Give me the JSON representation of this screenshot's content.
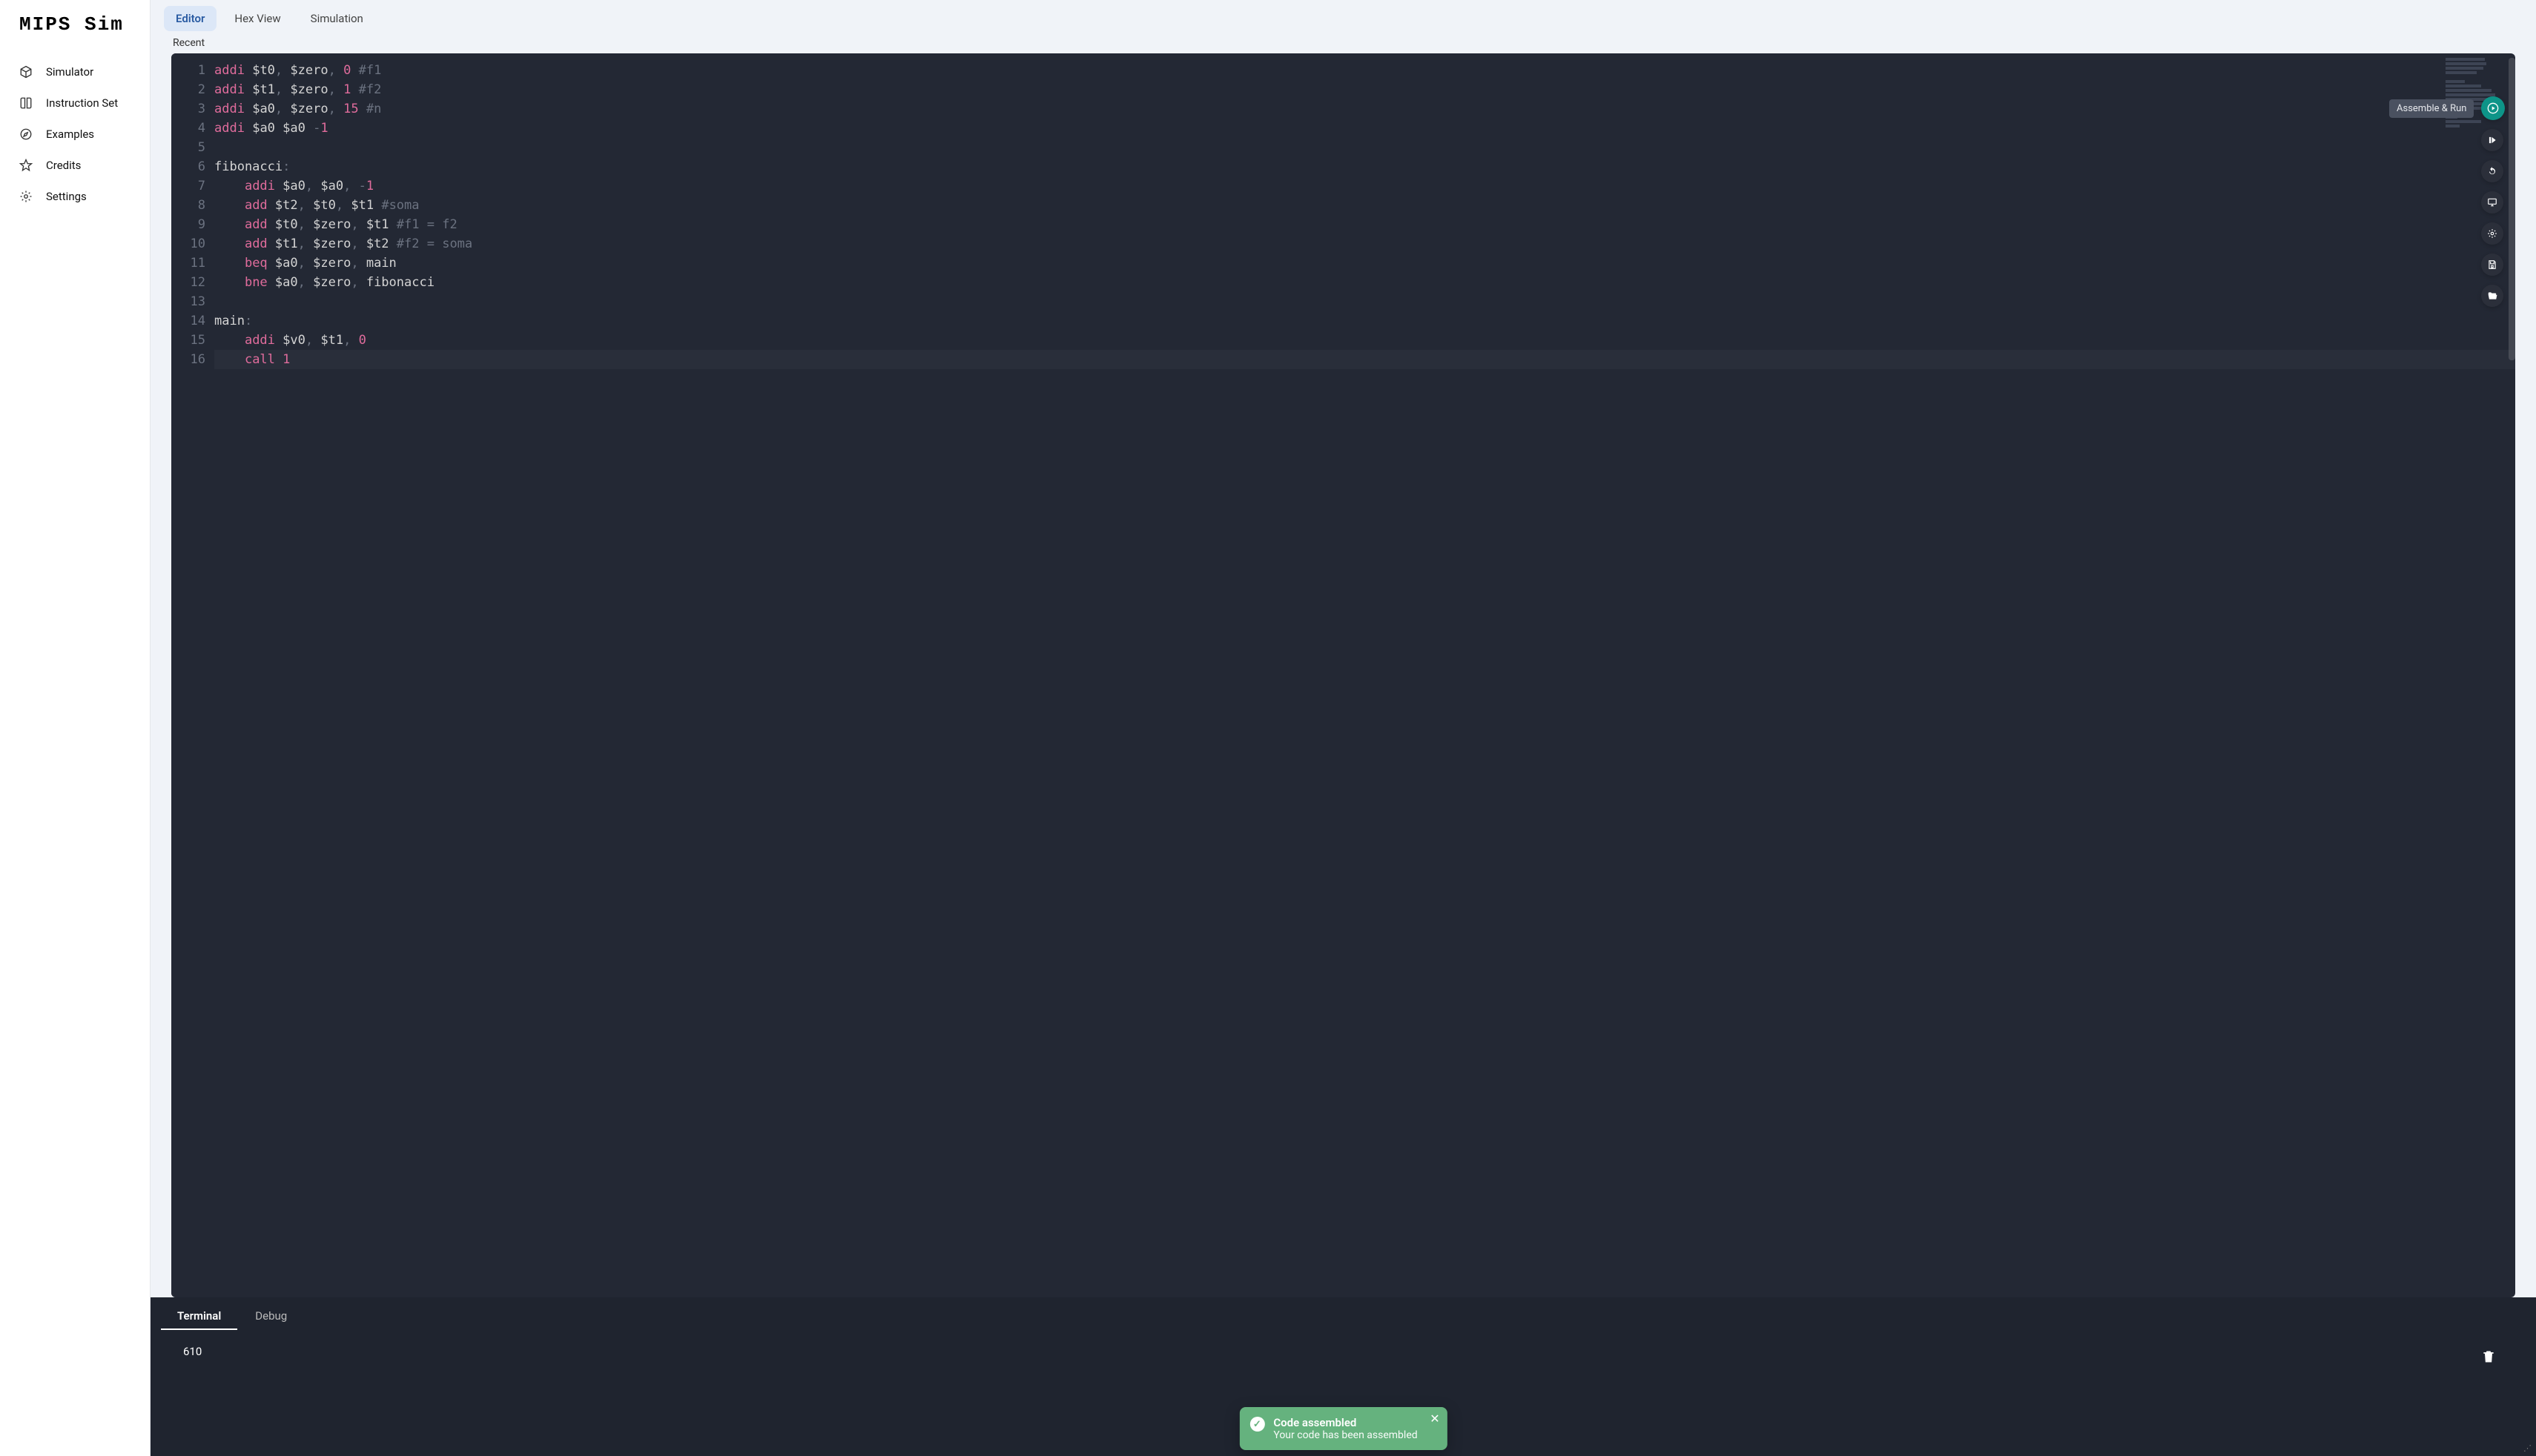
{
  "app": {
    "title": "MIPS Sim"
  },
  "sidebar": {
    "items": [
      {
        "label": "Simulator"
      },
      {
        "label": "Instruction Set"
      },
      {
        "label": "Examples"
      },
      {
        "label": "Credits"
      },
      {
        "label": "Settings"
      }
    ]
  },
  "tabs": {
    "editor": "Editor",
    "hex": "Hex View",
    "simulation": "Simulation"
  },
  "recent_label": "Recent",
  "code": {
    "lines": [
      {
        "n": "1",
        "tokens": [
          [
            "kw",
            "addi"
          ],
          [
            "txt",
            " "
          ],
          [
            "reg",
            "$t0"
          ],
          [
            "punct",
            ","
          ],
          [
            "txt",
            " "
          ],
          [
            "reg",
            "$zero"
          ],
          [
            "punct",
            ","
          ],
          [
            "txt",
            " "
          ],
          [
            "num",
            "0"
          ],
          [
            "txt",
            " "
          ],
          [
            "cmt",
            "#f1"
          ]
        ]
      },
      {
        "n": "2",
        "tokens": [
          [
            "kw",
            "addi"
          ],
          [
            "txt",
            " "
          ],
          [
            "reg",
            "$t1"
          ],
          [
            "punct",
            ","
          ],
          [
            "txt",
            " "
          ],
          [
            "reg",
            "$zero"
          ],
          [
            "punct",
            ","
          ],
          [
            "txt",
            " "
          ],
          [
            "num",
            "1"
          ],
          [
            "txt",
            " "
          ],
          [
            "cmt",
            "#f2"
          ]
        ]
      },
      {
        "n": "3",
        "tokens": [
          [
            "kw",
            "addi"
          ],
          [
            "txt",
            " "
          ],
          [
            "reg",
            "$a0"
          ],
          [
            "punct",
            ","
          ],
          [
            "txt",
            " "
          ],
          [
            "reg",
            "$zero"
          ],
          [
            "punct",
            ","
          ],
          [
            "txt",
            " "
          ],
          [
            "num",
            "15"
          ],
          [
            "txt",
            " "
          ],
          [
            "cmt",
            "#n"
          ]
        ]
      },
      {
        "n": "4",
        "tokens": [
          [
            "kw",
            "addi"
          ],
          [
            "txt",
            " "
          ],
          [
            "reg",
            "$a0"
          ],
          [
            "txt",
            " "
          ],
          [
            "reg",
            "$a0"
          ],
          [
            "txt",
            " "
          ],
          [
            "punct",
            "-"
          ],
          [
            "num",
            "1"
          ]
        ]
      },
      {
        "n": "5",
        "tokens": []
      },
      {
        "n": "6",
        "tokens": [
          [
            "lbl",
            "fibonacci"
          ],
          [
            "punct",
            ":"
          ]
        ]
      },
      {
        "n": "7",
        "indent": 1,
        "tokens": [
          [
            "kw",
            "addi"
          ],
          [
            "txt",
            " "
          ],
          [
            "reg",
            "$a0"
          ],
          [
            "punct",
            ","
          ],
          [
            "txt",
            " "
          ],
          [
            "reg",
            "$a0"
          ],
          [
            "punct",
            ","
          ],
          [
            "txt",
            " "
          ],
          [
            "punct",
            "-"
          ],
          [
            "num",
            "1"
          ]
        ]
      },
      {
        "n": "8",
        "indent": 1,
        "tokens": [
          [
            "kw",
            "add"
          ],
          [
            "txt",
            " "
          ],
          [
            "reg",
            "$t2"
          ],
          [
            "punct",
            ","
          ],
          [
            "txt",
            " "
          ],
          [
            "reg",
            "$t0"
          ],
          [
            "punct",
            ","
          ],
          [
            "txt",
            " "
          ],
          [
            "reg",
            "$t1"
          ],
          [
            "txt",
            " "
          ],
          [
            "cmt",
            "#soma"
          ]
        ]
      },
      {
        "n": "9",
        "indent": 1,
        "tokens": [
          [
            "kw",
            "add"
          ],
          [
            "txt",
            " "
          ],
          [
            "reg",
            "$t0"
          ],
          [
            "punct",
            ","
          ],
          [
            "txt",
            " "
          ],
          [
            "reg",
            "$zero"
          ],
          [
            "punct",
            ","
          ],
          [
            "txt",
            " "
          ],
          [
            "reg",
            "$t1"
          ],
          [
            "txt",
            " "
          ],
          [
            "cmt",
            "#f1 = f2"
          ]
        ]
      },
      {
        "n": "10",
        "indent": 1,
        "tokens": [
          [
            "kw",
            "add"
          ],
          [
            "txt",
            " "
          ],
          [
            "reg",
            "$t1"
          ],
          [
            "punct",
            ","
          ],
          [
            "txt",
            " "
          ],
          [
            "reg",
            "$zero"
          ],
          [
            "punct",
            ","
          ],
          [
            "txt",
            " "
          ],
          [
            "reg",
            "$t2"
          ],
          [
            "txt",
            " "
          ],
          [
            "cmt",
            "#f2 = soma"
          ]
        ]
      },
      {
        "n": "11",
        "indent": 1,
        "tokens": [
          [
            "kw",
            "beq"
          ],
          [
            "txt",
            " "
          ],
          [
            "reg",
            "$a0"
          ],
          [
            "punct",
            ","
          ],
          [
            "txt",
            " "
          ],
          [
            "reg",
            "$zero"
          ],
          [
            "punct",
            ","
          ],
          [
            "txt",
            " "
          ],
          [
            "lbl",
            "main"
          ]
        ]
      },
      {
        "n": "12",
        "indent": 1,
        "tokens": [
          [
            "kw",
            "bne"
          ],
          [
            "txt",
            " "
          ],
          [
            "reg",
            "$a0"
          ],
          [
            "punct",
            ","
          ],
          [
            "txt",
            " "
          ],
          [
            "reg",
            "$zero"
          ],
          [
            "punct",
            ","
          ],
          [
            "txt",
            " "
          ],
          [
            "lbl",
            "fibonacci"
          ]
        ]
      },
      {
        "n": "13",
        "tokens": []
      },
      {
        "n": "14",
        "tokens": [
          [
            "lbl",
            "main"
          ],
          [
            "punct",
            ":"
          ]
        ]
      },
      {
        "n": "15",
        "indent": 1,
        "tokens": [
          [
            "kw",
            "addi"
          ],
          [
            "txt",
            " "
          ],
          [
            "reg",
            "$v0"
          ],
          [
            "punct",
            ","
          ],
          [
            "txt",
            " "
          ],
          [
            "reg",
            "$t1"
          ],
          [
            "punct",
            ","
          ],
          [
            "txt",
            " "
          ],
          [
            "num",
            "0"
          ]
        ]
      },
      {
        "n": "16",
        "indent": 1,
        "current": true,
        "tokens": [
          [
            "kw",
            "call"
          ],
          [
            "txt",
            " "
          ],
          [
            "num",
            "1"
          ]
        ]
      }
    ]
  },
  "fabs": {
    "tooltip": "Assemble & Run"
  },
  "panel": {
    "tabs": {
      "terminal": "Terminal",
      "debug": "Debug"
    },
    "output": "610"
  },
  "toast": {
    "title": "Code assembled",
    "message": "Your code has been assembled"
  }
}
